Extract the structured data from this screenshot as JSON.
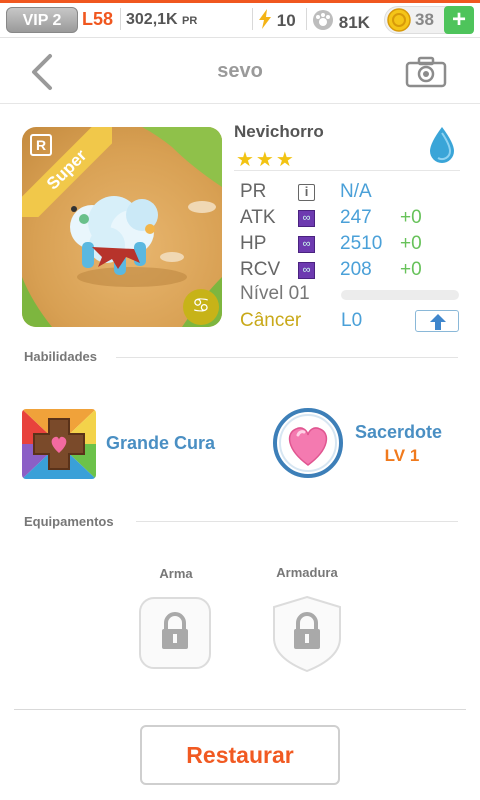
{
  "status_bar": {
    "vip": "VIP 2",
    "level": "L58",
    "power": "302,1K",
    "power_unit": "PR",
    "energy": "10",
    "paws": "81K",
    "coins": "38",
    "plus": "+"
  },
  "nav": {
    "title": "sevo"
  },
  "hero": {
    "name": "Nevichorro",
    "stars": "★★★",
    "rarity_badge": "R",
    "ribbon": "Super",
    "sign_glyph": "♋",
    "stats": [
      {
        "label": "PR",
        "value": "N/A",
        "bonus": ""
      },
      {
        "label": "ATK",
        "value": "247",
        "bonus": "+0"
      },
      {
        "label": "HP",
        "value": "2510",
        "bonus": "+0"
      },
      {
        "label": "RCV",
        "value": "208",
        "bonus": "+0"
      }
    ],
    "level_label": "Nível 01",
    "exp_fraction": 0,
    "sign_name": "Câncer",
    "sign_level": "L0",
    "element_color": "#4db6e8"
  },
  "skills": {
    "section_title": "Habilidades",
    "active_name": "Grande Cura",
    "leader_name": "Sacerdote",
    "leader_level": "LV 1"
  },
  "equipment": {
    "section_title": "Equipamentos",
    "weapon_label": "Arma",
    "armor_label": "Armadura"
  },
  "footer": {
    "restore_label": "Restaurar"
  },
  "colors": {
    "accent": "#f15a22",
    "link": "#4a8fc3",
    "bonus": "#67c25a"
  }
}
